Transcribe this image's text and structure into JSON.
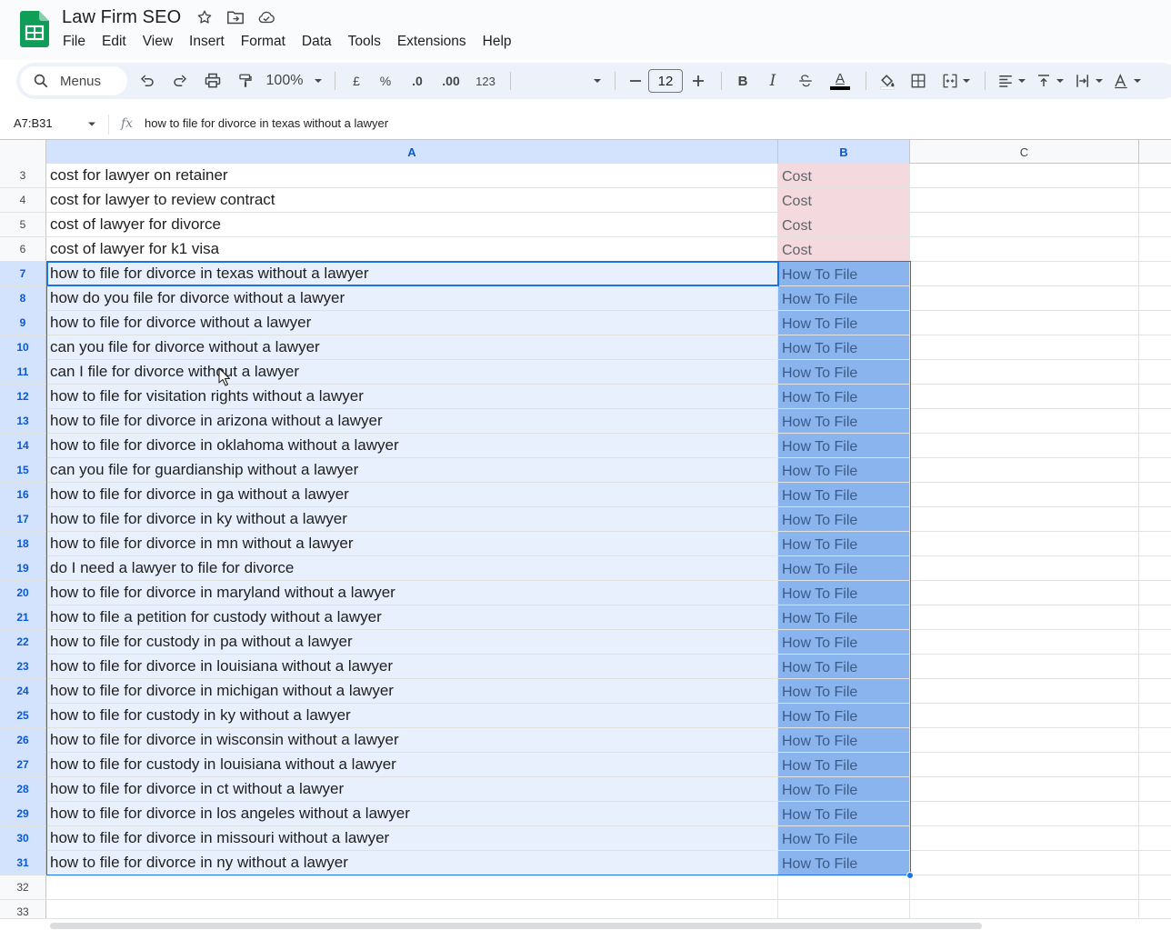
{
  "document": {
    "title": "Law Firm SEO",
    "menus": [
      "File",
      "Edit",
      "View",
      "Insert",
      "Format",
      "Data",
      "Tools",
      "Extensions",
      "Help"
    ]
  },
  "toolbar": {
    "search_label": "Menus",
    "zoom": "100%",
    "currency": "£",
    "percent": "%",
    "decrease_decimal": ".0",
    "increase_decimal": ".00",
    "number_format": "123",
    "font_size": "12",
    "bold": "B",
    "italic": "I",
    "text_color": "A"
  },
  "formula_bar": {
    "name_box": "A7:B31",
    "fx": "fx",
    "value": "how to file for divorce in texas without a lawyer"
  },
  "columns": [
    {
      "label": "A",
      "selected": true
    },
    {
      "label": "B",
      "selected": true
    },
    {
      "label": "C",
      "selected": false
    }
  ],
  "rows": [
    {
      "num": "3",
      "a": "cost for lawyer on retainer",
      "b": "Cost",
      "sel": false
    },
    {
      "num": "4",
      "a": "cost for lawyer to review contract",
      "b": "Cost",
      "sel": false
    },
    {
      "num": "5",
      "a": "cost of lawyer for divorce",
      "b": "Cost",
      "sel": false
    },
    {
      "num": "6",
      "a": "cost of lawyer for k1 visa",
      "b": "Cost",
      "sel": false
    },
    {
      "num": "7",
      "a": "how to file for divorce in texas without a lawyer",
      "b": "How To File",
      "sel": true
    },
    {
      "num": "8",
      "a": "how do you file for divorce without a lawyer",
      "b": "How To File",
      "sel": true
    },
    {
      "num": "9",
      "a": "how to file for divorce without a lawyer",
      "b": "How To File",
      "sel": true
    },
    {
      "num": "10",
      "a": "can you file for divorce without a lawyer",
      "b": "How To File",
      "sel": true
    },
    {
      "num": "11",
      "a": "can I file for divorce without a lawyer",
      "b": "How To File",
      "sel": true
    },
    {
      "num": "12",
      "a": "how to file for visitation rights without a lawyer",
      "b": "How To File",
      "sel": true
    },
    {
      "num": "13",
      "a": "how to file for divorce in arizona without a lawyer",
      "b": "How To File",
      "sel": true
    },
    {
      "num": "14",
      "a": "how to file for divorce in oklahoma without a lawyer",
      "b": "How To File",
      "sel": true
    },
    {
      "num": "15",
      "a": "can you file for guardianship without a lawyer",
      "b": "How To File",
      "sel": true
    },
    {
      "num": "16",
      "a": "how to file for divorce in ga without a lawyer",
      "b": "How To File",
      "sel": true
    },
    {
      "num": "17",
      "a": "how to file for divorce in ky without a lawyer",
      "b": "How To File",
      "sel": true
    },
    {
      "num": "18",
      "a": "how to file for divorce in mn without a lawyer",
      "b": "How To File",
      "sel": true
    },
    {
      "num": "19",
      "a": "do I need a lawyer to file for divorce",
      "b": "How To File",
      "sel": true
    },
    {
      "num": "20",
      "a": "how to file for divorce in maryland without a lawyer",
      "b": "How To File",
      "sel": true
    },
    {
      "num": "21",
      "a": "how to file a petition for custody without a lawyer",
      "b": "How To File",
      "sel": true
    },
    {
      "num": "22",
      "a": "how to file for custody in pa without a lawyer",
      "b": "How To File",
      "sel": true
    },
    {
      "num": "23",
      "a": "how to file for divorce in louisiana without a lawyer",
      "b": "How To File",
      "sel": true
    },
    {
      "num": "24",
      "a": "how to file for divorce in michigan without a lawyer",
      "b": "How To File",
      "sel": true
    },
    {
      "num": "25",
      "a": "how to file for custody in ky without a lawyer",
      "b": "How To File",
      "sel": true
    },
    {
      "num": "26",
      "a": "how to file for divorce in wisconsin without a lawyer",
      "b": "How To File",
      "sel": true
    },
    {
      "num": "27",
      "a": "how to file for custody in louisiana without a lawyer",
      "b": "How To File",
      "sel": true
    },
    {
      "num": "28",
      "a": "how to file for divorce in ct without a lawyer",
      "b": "How To File",
      "sel": true
    },
    {
      "num": "29",
      "a": "how to file for divorce in los angeles without a lawyer",
      "b": "How To File",
      "sel": true
    },
    {
      "num": "30",
      "a": "how to file for divorce in missouri without a lawyer",
      "b": "How To File",
      "sel": true
    },
    {
      "num": "31",
      "a": "how to file for divorce in ny without a lawyer",
      "b": "How To File",
      "sel": true
    },
    {
      "num": "32",
      "a": "",
      "b": "",
      "sel": false
    },
    {
      "num": "33",
      "a": "",
      "b": "",
      "sel": false
    }
  ],
  "colors": {
    "selection_border": "#1a73e8",
    "cost_fill": "#f4dadf",
    "how_to_fill": "#8ab4ee",
    "sheets_green": "#0f9d58"
  }
}
